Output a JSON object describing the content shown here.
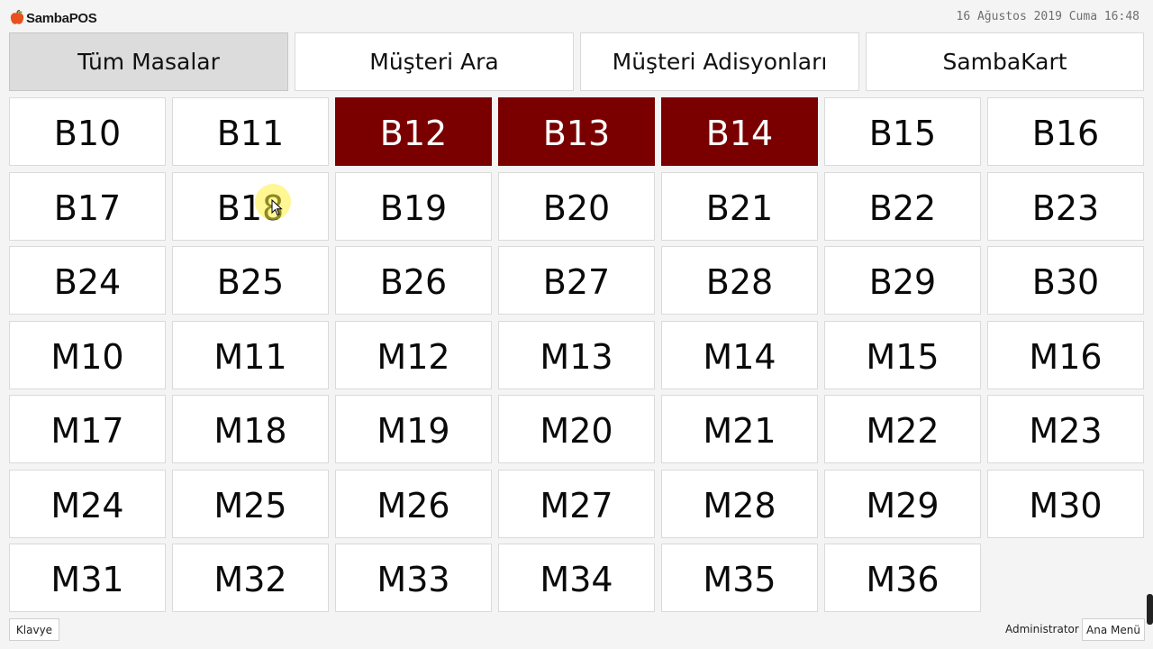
{
  "app": {
    "logo_text": "SambaPOS",
    "datetime": "16 Ağustos 2019 Cuma 16:48",
    "colors": {
      "occupied": "#7a0000",
      "logo_accent": "#e8501c"
    }
  },
  "nav": {
    "items": [
      {
        "label": "Tüm Masalar",
        "active": true
      },
      {
        "label": "Müşteri Ara",
        "active": false
      },
      {
        "label": "Müşteri Adisyonları",
        "active": false
      },
      {
        "label": "SambaKart",
        "active": false
      }
    ]
  },
  "tables": [
    {
      "label": "B10",
      "status": "available"
    },
    {
      "label": "B11",
      "status": "available"
    },
    {
      "label": "B12",
      "status": "occupied"
    },
    {
      "label": "B13",
      "status": "occupied"
    },
    {
      "label": "B14",
      "status": "occupied"
    },
    {
      "label": "B15",
      "status": "available"
    },
    {
      "label": "B16",
      "status": "available"
    },
    {
      "label": "B17",
      "status": "available"
    },
    {
      "label": "B18",
      "status": "available"
    },
    {
      "label": "B19",
      "status": "available"
    },
    {
      "label": "B20",
      "status": "available"
    },
    {
      "label": "B21",
      "status": "available"
    },
    {
      "label": "B22",
      "status": "available"
    },
    {
      "label": "B23",
      "status": "available"
    },
    {
      "label": "B24",
      "status": "available"
    },
    {
      "label": "B25",
      "status": "available"
    },
    {
      "label": "B26",
      "status": "available"
    },
    {
      "label": "B27",
      "status": "available"
    },
    {
      "label": "B28",
      "status": "available"
    },
    {
      "label": "B29",
      "status": "available"
    },
    {
      "label": "B30",
      "status": "available"
    },
    {
      "label": "M10",
      "status": "available"
    },
    {
      "label": "M11",
      "status": "available"
    },
    {
      "label": "M12",
      "status": "available"
    },
    {
      "label": "M13",
      "status": "available"
    },
    {
      "label": "M14",
      "status": "available"
    },
    {
      "label": "M15",
      "status": "available"
    },
    {
      "label": "M16",
      "status": "available"
    },
    {
      "label": "M17",
      "status": "available"
    },
    {
      "label": "M18",
      "status": "available"
    },
    {
      "label": "M19",
      "status": "available"
    },
    {
      "label": "M20",
      "status": "available"
    },
    {
      "label": "M21",
      "status": "available"
    },
    {
      "label": "M22",
      "status": "available"
    },
    {
      "label": "M23",
      "status": "available"
    },
    {
      "label": "M24",
      "status": "available"
    },
    {
      "label": "M25",
      "status": "available"
    },
    {
      "label": "M26",
      "status": "available"
    },
    {
      "label": "M27",
      "status": "available"
    },
    {
      "label": "M28",
      "status": "available"
    },
    {
      "label": "M29",
      "status": "available"
    },
    {
      "label": "M30",
      "status": "available"
    },
    {
      "label": "M31",
      "status": "available"
    },
    {
      "label": "M32",
      "status": "available"
    },
    {
      "label": "M33",
      "status": "available"
    },
    {
      "label": "M34",
      "status": "available"
    },
    {
      "label": "M35",
      "status": "available"
    },
    {
      "label": "M36",
      "status": "available"
    }
  ],
  "footer": {
    "keyboard_label": "Klavye",
    "user": "Administrator",
    "main_menu_label": "Ana Menü"
  }
}
